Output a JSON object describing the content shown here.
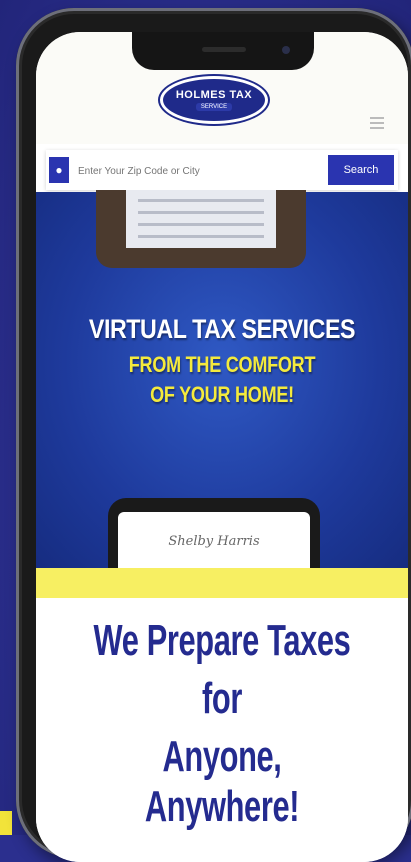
{
  "logo": {
    "line1": "HOLMES TAX",
    "line2": "SERVICE"
  },
  "search": {
    "placeholder": "Enter Your Zip Code or City",
    "button_label": "Search"
  },
  "hero": {
    "line1": "VIRTUAL TAX SERVICES",
    "line2": "FROM THE COMFORT",
    "line3": "OF YOUR HOME!",
    "signature": "Shelby Harris"
  },
  "headline": {
    "line1": "We Prepare Taxes",
    "line2": "for",
    "line3": "Anyone, Anywhere!"
  },
  "colors": {
    "brand_blue": "#242b8f",
    "accent_yellow": "#f4ea3c",
    "background": "#2b2f8e"
  }
}
